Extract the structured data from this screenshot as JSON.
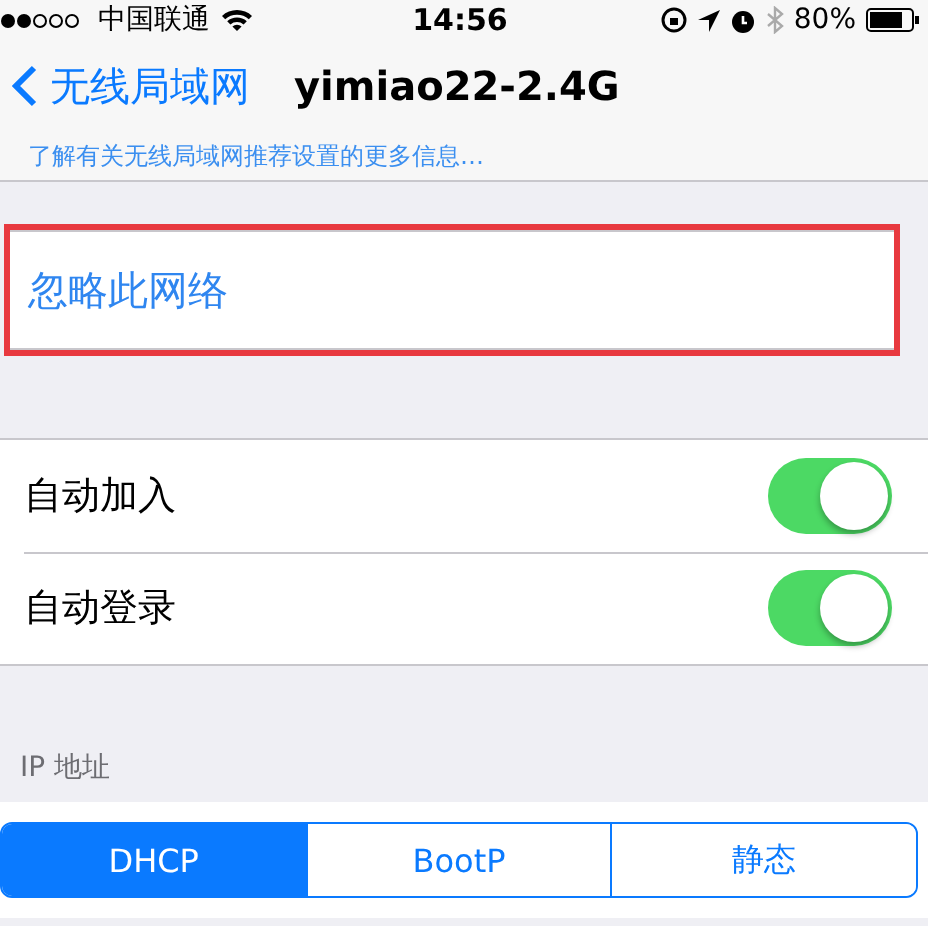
{
  "status_bar": {
    "carrier": "中国联通",
    "time": "14:56",
    "battery": "80%"
  },
  "nav": {
    "back": "无线局域网",
    "title": "yimiao22-2.4G"
  },
  "info_link": "了解有关无线局域网推荐设置的更多信息…",
  "forget": {
    "label": "忽略此网络",
    "highlighted": true
  },
  "toggles": [
    {
      "label": "自动加入",
      "on": true
    },
    {
      "label": "自动登录",
      "on": true
    }
  ],
  "ip_section": {
    "header": "IP 地址",
    "modes": [
      {
        "label": "DHCP",
        "selected": true
      },
      {
        "label": "BootP",
        "selected": false
      },
      {
        "label": "静态",
        "selected": false
      }
    ]
  }
}
